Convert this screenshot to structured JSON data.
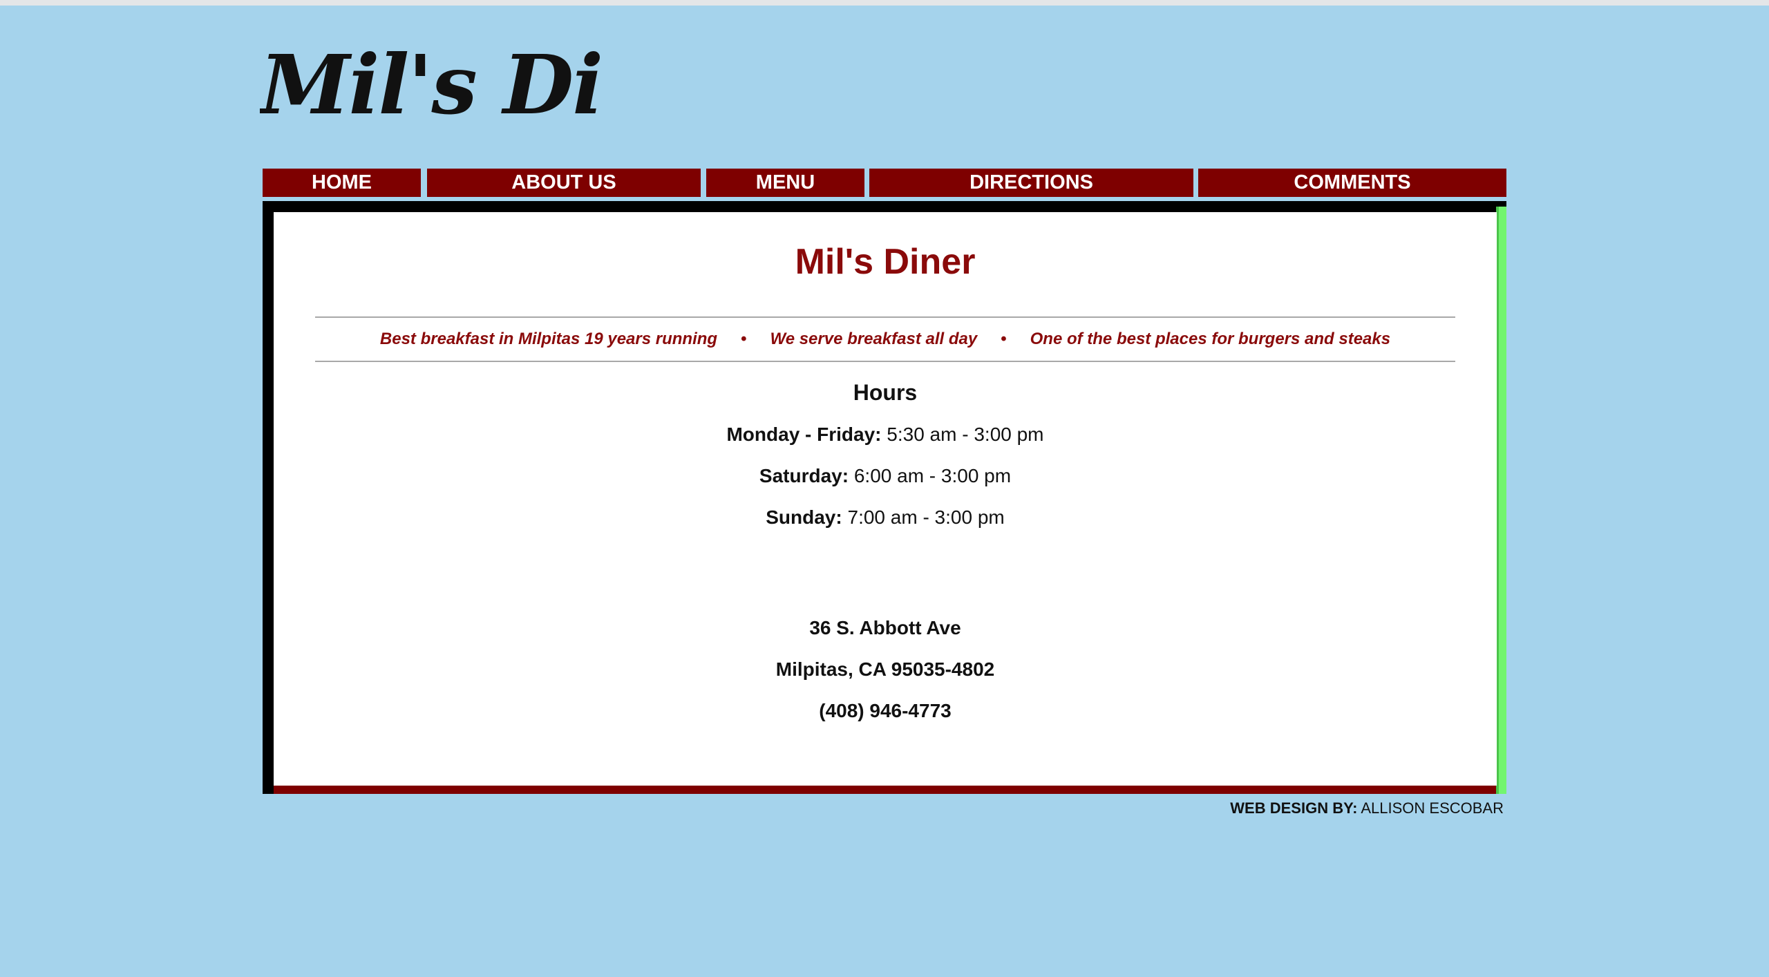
{
  "site": {
    "logo_text": "Mil's Diner"
  },
  "nav": {
    "items": [
      {
        "label": "HOME"
      },
      {
        "label": "ABOUT US"
      },
      {
        "label": "MENU"
      },
      {
        "label": "DIRECTIONS"
      },
      {
        "label": "COMMENTS"
      }
    ]
  },
  "main": {
    "title": "Mil's Diner",
    "taglines": [
      "Best breakfast in Milpitas 19 years running",
      "We serve breakfast all day",
      "One of the best places for burgers and steaks"
    ],
    "bullet": "•",
    "hours": {
      "heading": "Hours",
      "rows": [
        {
          "day": "Monday - Friday:",
          "time": "5:30 am - 3:00 pm"
        },
        {
          "day": "Saturday:",
          "time": "6:00 am - 3:00 pm"
        },
        {
          "day": "Sunday:",
          "time": "7:00 am - 3:00 pm"
        }
      ]
    },
    "address": {
      "street": "36 S. Abbott Ave",
      "city": "Milpitas, CA 95035-4802",
      "phone": "(408) 946-4773"
    }
  },
  "footer": {
    "label": "WEB DESIGN BY:",
    "name": "ALLISON ESCOBAR"
  },
  "colors": {
    "background": "#a5d3ec",
    "brand_red": "#7e0000",
    "accent_green": "#72f56f"
  }
}
